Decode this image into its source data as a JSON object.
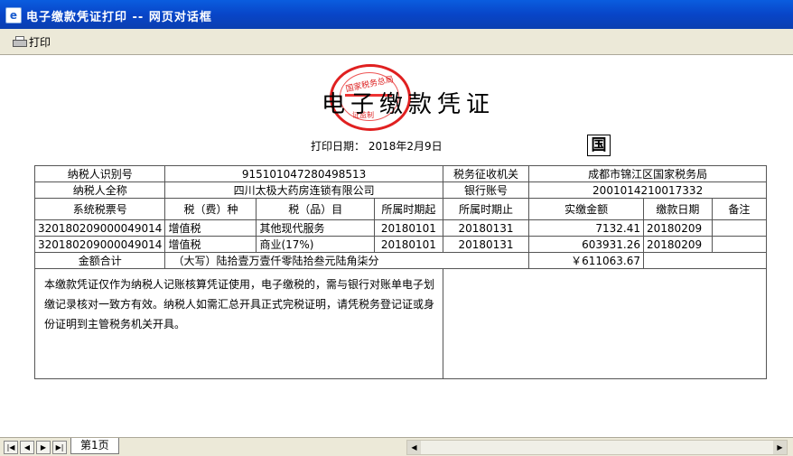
{
  "window": {
    "title": "电子缴款凭证打印  --  网页对话框",
    "icon": "ie-icon"
  },
  "toolbar": {
    "print_label": "打印"
  },
  "doc": {
    "title": "电子缴款凭证",
    "print_date_label": "打印日期：",
    "print_date": "2018年2月9日",
    "guo_char": "国",
    "stamp_text_top": "国家税务总局",
    "stamp_text_bottom": "证监制"
  },
  "info": {
    "taxpayer_id_label": "纳税人识别号",
    "taxpayer_id": "915101047280498513",
    "tax_authority_label": "税务征收机关",
    "tax_authority": "成都市锦江区国家税务局",
    "taxpayer_name_label": "纳税人全称",
    "taxpayer_name": "四川太极大药房连锁有限公司",
    "bank_account_label": "银行账号",
    "bank_account": "2001014210017332"
  },
  "table": {
    "headers": [
      "系统税票号",
      "税（费）种",
      "税（品）目",
      "所属时期起",
      "所属时期止",
      "实缴金额",
      "缴款日期",
      "备注"
    ],
    "rows": [
      [
        "320180209000049014",
        "增值税",
        "其他现代服务",
        "20180101",
        "20180131",
        "7132.41",
        "20180209",
        ""
      ],
      [
        "320180209000049014",
        "增值税",
        "商业(17%)",
        "20180101",
        "20180131",
        "603931.26",
        "20180209",
        ""
      ]
    ]
  },
  "total": {
    "label": "金额合计",
    "in_words": "（大写）陆拾壹万壹仟零陆拾叁元陆角柒分",
    "amount": "￥611063.67"
  },
  "note": "本缴款凭证仅作为纳税人记账核算凭证使用，电子缴税的，需与银行对账单电子划缴记录核对一致方有效。纳税人如需汇总开具正式完税证明，请凭税务登记证或身份证明到主管税务机关开具。",
  "sheet": {
    "tab_label": "第1页"
  }
}
